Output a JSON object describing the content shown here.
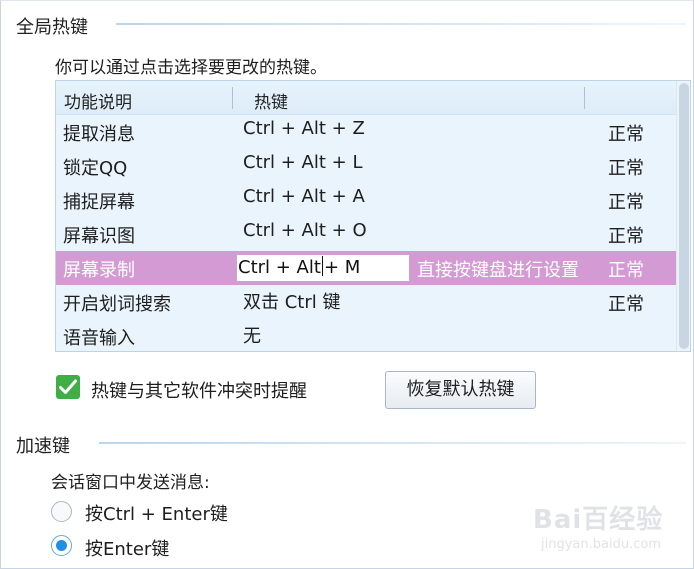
{
  "global_hotkeys": {
    "section_title": "全局热键",
    "description": "你可以通过点击选择要更改的热键。",
    "columns": [
      "功能说明",
      "热键"
    ],
    "rows": [
      {
        "function": "提取消息",
        "hotkey": "Ctrl + Alt + Z",
        "status": "正常"
      },
      {
        "function": "锁定QQ",
        "hotkey": "Ctrl + Alt + L",
        "status": "正常"
      },
      {
        "function": "捕捉屏幕",
        "hotkey": "Ctrl + Alt + A",
        "status": "正常"
      },
      {
        "function": "屏幕识图",
        "hotkey": "Ctrl + Alt + O",
        "status": "正常"
      },
      {
        "function": "屏幕录制",
        "hotkey_before_caret": "Ctrl + Alt",
        "hotkey_after_caret": "+ M",
        "hint": "直接按键盘进行设置",
        "status": "正常",
        "selected": true
      },
      {
        "function": "开启划词搜索",
        "hotkey": "双击 Ctrl 键",
        "status": "正常"
      },
      {
        "function": "语音输入",
        "hotkey": "无",
        "status": ""
      }
    ],
    "conflict_reminder_label": "热键与其它软件冲突时提醒",
    "conflict_reminder_checked": true,
    "restore_button_label": "恢复默认热键"
  },
  "accelerator": {
    "section_title": "加速键",
    "send_message_label": "会话窗口中发送消息:",
    "options": [
      {
        "label": "按Ctrl + Enter键",
        "selected": false
      },
      {
        "label": "按Enter键",
        "selected": true
      }
    ]
  },
  "watermark": {
    "brand": "Bai百经验",
    "url": "jingyan.baidu.com"
  },
  "colors": {
    "row_background": "#eaf4fc",
    "selected_row": "#d49ad4",
    "checkbox_green": "#3fae45",
    "radio_blue": "#1e8fe6"
  }
}
